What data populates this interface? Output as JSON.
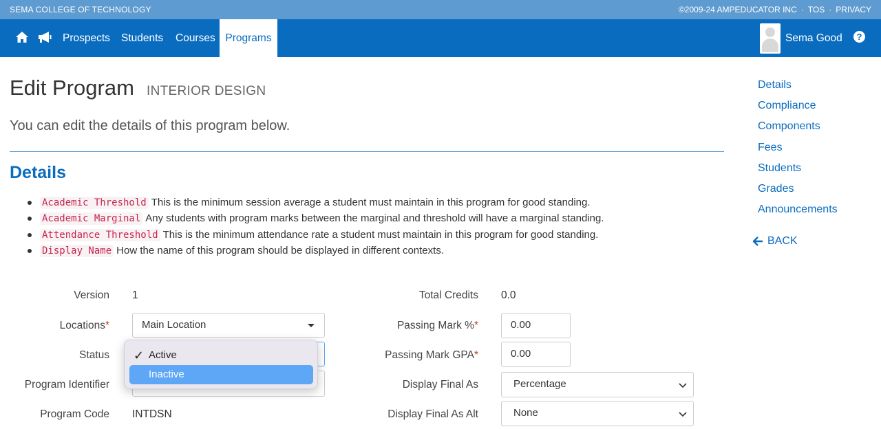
{
  "topbar": {
    "org": "SEMA COLLEGE OF TECHNOLOGY",
    "copyright": "©2009-24 AMPEDUCATOR INC",
    "sep": "·",
    "tos": "TOS",
    "privacy": "PRIVACY"
  },
  "nav": {
    "home_icon": "home-icon",
    "announce_icon": "megaphone-icon",
    "links": [
      "Prospects",
      "Students",
      "Courses",
      "Programs"
    ],
    "active": "Programs",
    "user": "Sema Good",
    "help_icon": "question-circle-icon",
    "help_glyph": "?"
  },
  "page": {
    "title": "Edit Program",
    "subtitle": "INTERIOR DESIGN",
    "lead": "You can edit the details of this program below.",
    "section": "Details"
  },
  "definitions": [
    {
      "term": "Academic Threshold",
      "desc": "This is the minimum session average a student must maintain in this program for good standing."
    },
    {
      "term": "Academic Marginal",
      "desc": "Any students with program marks between the marginal and threshold will have a marginal standing."
    },
    {
      "term": "Attendance Threshold",
      "desc": "This is the minimum attendance rate a student must maintain in this program for good standing."
    },
    {
      "term": "Display Name",
      "desc": "How the name of this program should be displayed in different contexts."
    }
  ],
  "form": {
    "version_label": "Version",
    "version_value": "1",
    "locations_label": "Locations",
    "locations_value": "Main Location",
    "status_label": "Status",
    "program_identifier_label": "Program Identifier",
    "program_code_label": "Program Code",
    "program_code_value": "INTDSN",
    "total_credits_label": "Total Credits",
    "total_credits_value": "0.0",
    "passing_mark_label": "Passing Mark %",
    "passing_mark_value": "0.00",
    "passing_gpa_label": "Passing Mark GPA",
    "passing_gpa_value": "0.00",
    "display_final_label": "Display Final As",
    "display_final_value": "Percentage",
    "display_final_alt_label": "Display Final As Alt",
    "display_final_alt_value": "None",
    "required_mark": "*"
  },
  "status_dropdown": {
    "options": [
      "Active",
      "Inactive"
    ],
    "selected": "Active",
    "highlighted": "Inactive",
    "check": "✓"
  },
  "side_nav": {
    "items": [
      "Details",
      "Compliance",
      "Components",
      "Fees",
      "Students",
      "Grades",
      "Announcements"
    ],
    "back": "BACK"
  }
}
